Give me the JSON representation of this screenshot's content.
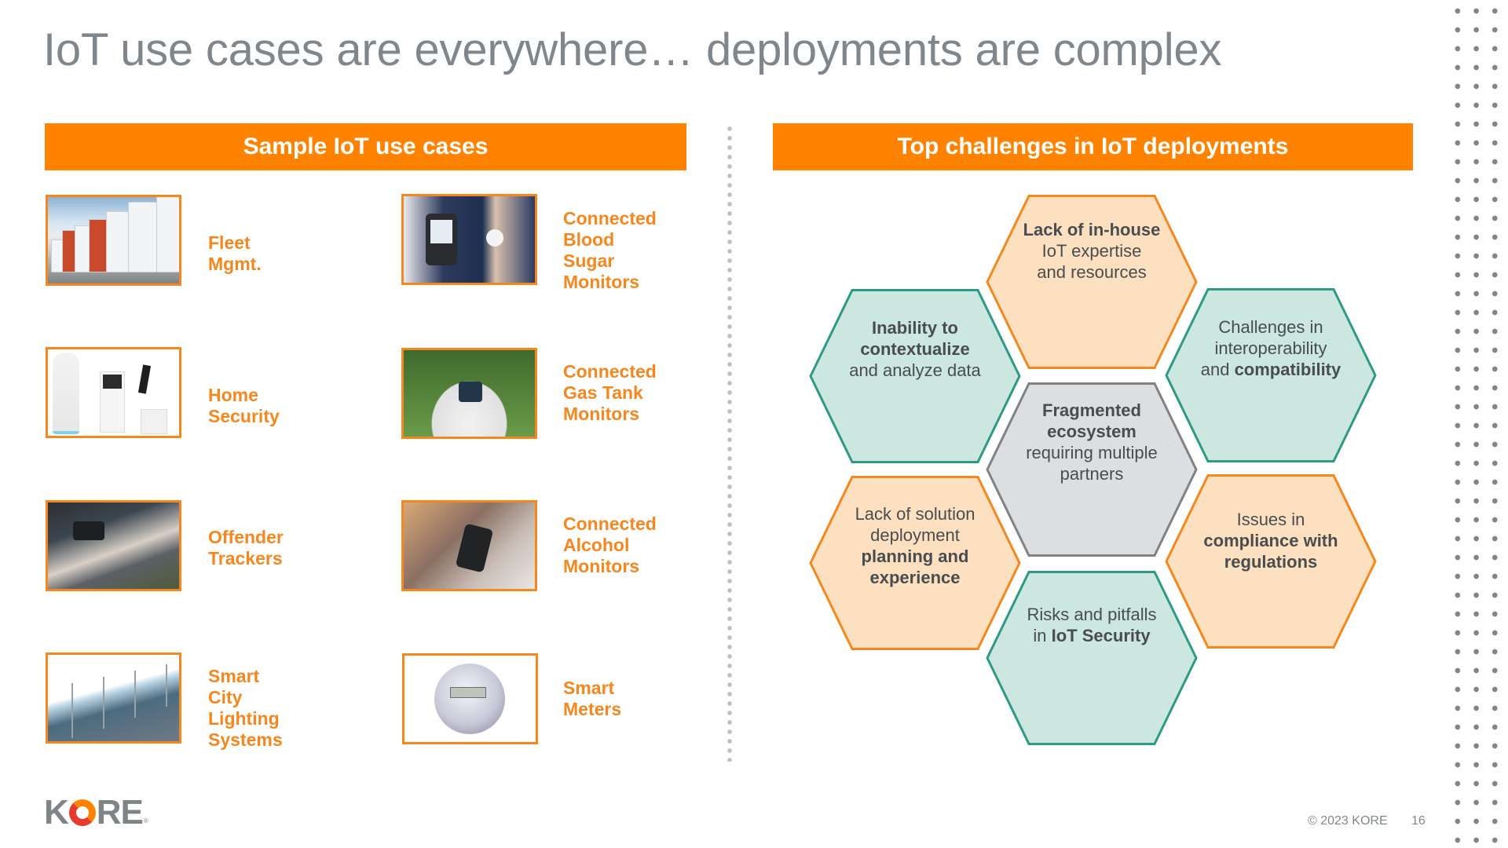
{
  "title": "IoT use cases are everywhere… deployments are complex",
  "left_section": {
    "header": "Sample IoT use cases",
    "use_cases": [
      {
        "label": "Fleet Mgmt.",
        "image": "trucks-photo"
      },
      {
        "label": "Connected\nBlood Sugar\nMonitors",
        "image": "glucose-monitor-photo"
      },
      {
        "label": "Home Security",
        "image": "home-security-kit-photo"
      },
      {
        "label": "Connected\nGas Tank\nMonitors",
        "image": "gas-tank-sensor-photo"
      },
      {
        "label": "Offender\nTrackers",
        "image": "ankle-monitor-photo"
      },
      {
        "label": "Connected\nAlcohol\nMonitors",
        "image": "alcohol-monitor-photo"
      },
      {
        "label": "Smart City\nLighting\nSystems",
        "image": "smart-city-illustration"
      },
      {
        "label": "Smart\nMeters",
        "image": "smart-meter-photo"
      }
    ]
  },
  "right_section": {
    "header": "Top challenges in IoT deployments",
    "challenges": [
      {
        "id": "in-house-expertise",
        "theme": "peach",
        "parts": [
          {
            "b": "Lack of in-house"
          },
          {
            "t": "IoT expertise"
          },
          {
            "t": "and resources"
          }
        ]
      },
      {
        "id": "contextualize-data",
        "theme": "teal",
        "parts": [
          {
            "b": "Inability to"
          },
          {
            "b": "contextualize"
          },
          {
            "t": "and analyze data"
          }
        ]
      },
      {
        "id": "interoperability",
        "theme": "teal",
        "parts": [
          {
            "t": "Challenges in"
          },
          {
            "t": "interoperability"
          },
          {
            "t": "and ",
            "b2": "compatibility"
          }
        ]
      },
      {
        "id": "fragmented-ecosystem",
        "theme": "grey",
        "parts": [
          {
            "b": "Fragmented"
          },
          {
            "b": "ecosystem"
          },
          {
            "t": "requiring multiple"
          },
          {
            "t": "partners"
          }
        ]
      },
      {
        "id": "solution-deployment",
        "theme": "peach",
        "parts": [
          {
            "t": "Lack of solution"
          },
          {
            "t": "deployment"
          },
          {
            "b": "planning and"
          },
          {
            "b": "experience"
          }
        ]
      },
      {
        "id": "compliance",
        "theme": "peach",
        "parts": [
          {
            "t": "Issues in"
          },
          {
            "b": "compliance with"
          },
          {
            "b": "regulations"
          }
        ]
      },
      {
        "id": "iot-security",
        "theme": "teal",
        "parts": [
          {
            "t": "Risks and pitfalls"
          },
          {
            "t": "in ",
            "b2": "IoT Security"
          }
        ]
      }
    ]
  },
  "colors": {
    "accent_orange": "#ff8300",
    "label_orange": "#f5871f",
    "title_grey": "#80878c",
    "teal_fill": "#cce6e0",
    "teal_stroke": "#2e9a85",
    "peach_fill": "#fde0c0",
    "peach_stroke": "#f5871f",
    "grey_fill": "#dcdee0",
    "grey_stroke": "#7f8386"
  },
  "footer": {
    "logo_text": "KORE",
    "copyright": "© 2023 KORE",
    "page_number": "16"
  }
}
